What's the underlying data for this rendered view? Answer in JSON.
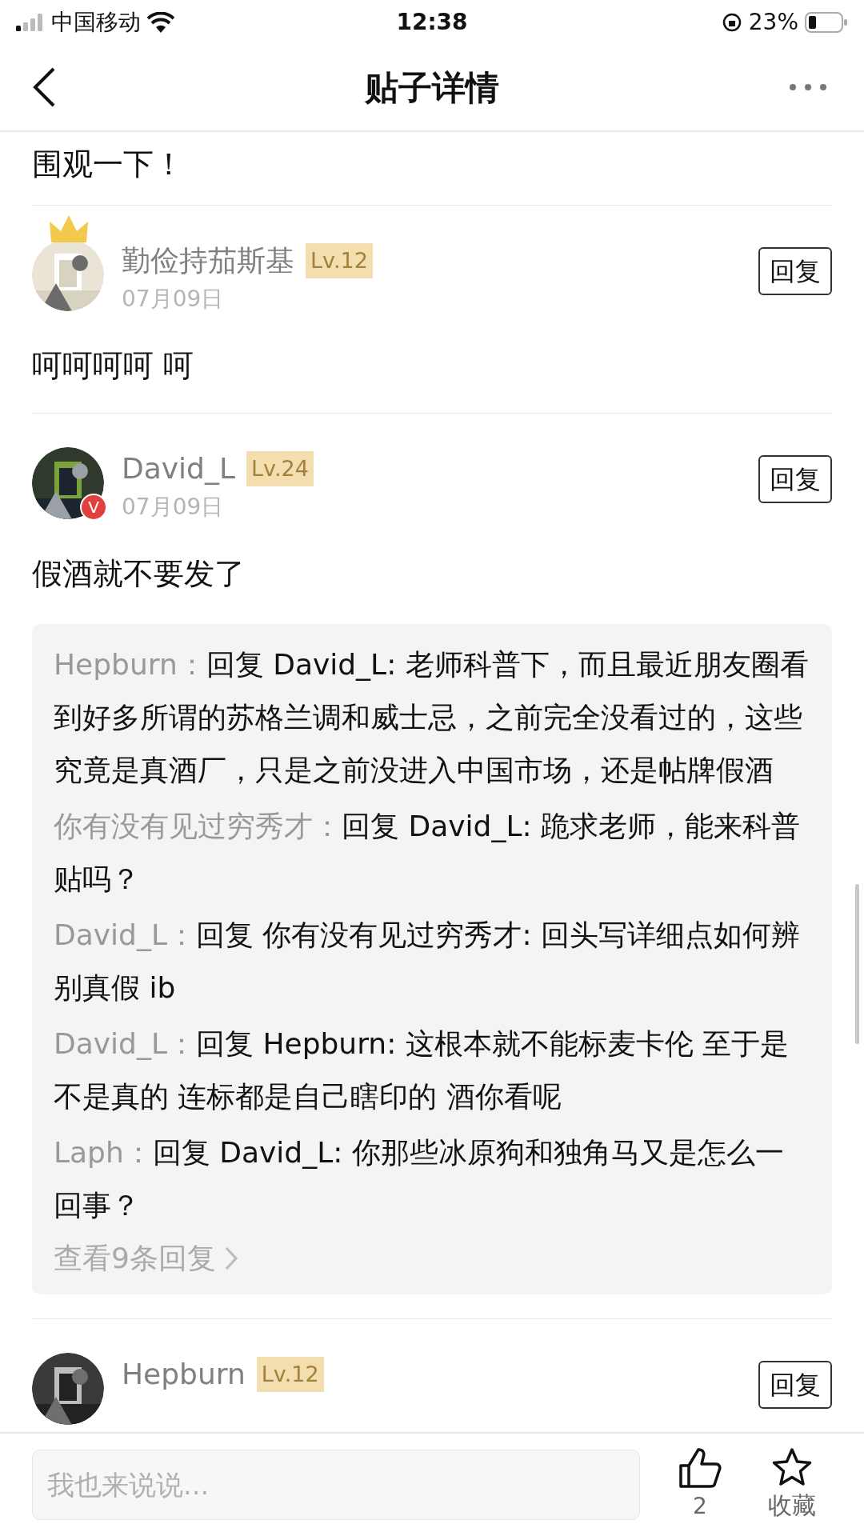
{
  "status_bar": {
    "carrier": "中国移动",
    "time": "12:38",
    "battery": "23%"
  },
  "nav": {
    "title": "贴子详情"
  },
  "post_tail": "围观一下！",
  "comments": [
    {
      "name": "勤俭持茄斯基",
      "level": "Lv.12",
      "date": "07月09日",
      "reply_button": "回复",
      "body": "呵呵呵呵 呵",
      "crown": true
    },
    {
      "name": "David_L",
      "level": "Lv.24",
      "date": "07月09日",
      "reply_button": "回复",
      "body": "假酒就不要发了",
      "crown": false,
      "verified": "V",
      "replies": [
        {
          "author": "Hepburn：",
          "text": "回复 David_L: 老师科普下，而且最近朋友圈看到好多所谓的苏格兰调和威士忌，之前完全没看过的，这些究竟是真酒厂，只是之前没进入中国市场，还是帖牌假酒"
        },
        {
          "author": "你有没有见过穷秀才：",
          "text": "回复 David_L: 跪求老师，能来科普贴吗？"
        },
        {
          "author": "David_L：",
          "text": "回复 你有没有见过穷秀才: 回头写详细点如何辨别真假 ib"
        },
        {
          "author": "David_L：",
          "text": "回复 Hepburn: 这根本就不能标麦卡伦 至于是不是真的 连标都是自己瞎印的 酒你看呢"
        },
        {
          "author": "Laph：",
          "text": "回复 David_L: 你那些冰原狗和独角马又是怎么一回事？"
        }
      ],
      "more_replies": "查看9条回复"
    },
    {
      "name": "Hepburn",
      "level": "Lv.12",
      "reply_button": "回复",
      "crown": false
    }
  ],
  "bottom_bar": {
    "placeholder": "我也来说说...",
    "like_count": "2",
    "favorite_label": "收藏"
  }
}
